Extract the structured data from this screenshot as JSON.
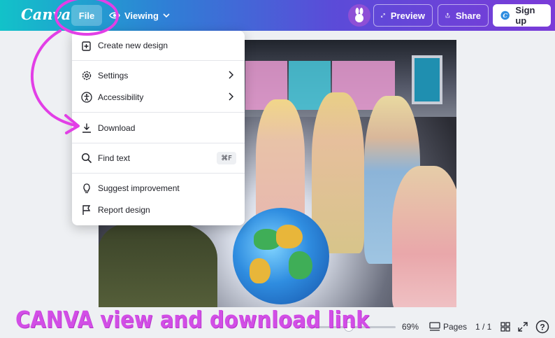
{
  "topbar": {
    "logo": "Canva",
    "file_label": "File",
    "viewing_label": "Viewing",
    "preview_label": "Preview",
    "share_label": "Share",
    "signup_label": "Sign up"
  },
  "menu": {
    "items": [
      {
        "label": "Create new design",
        "icon": "add-page-icon"
      },
      {
        "label": "Settings",
        "icon": "gear-icon"
      },
      {
        "label": "Accessibility",
        "icon": "accessibility-icon"
      },
      {
        "label": "Download",
        "icon": "download-icon"
      },
      {
        "label": "Find text",
        "icon": "search-icon",
        "shortcut": "⌘F"
      },
      {
        "label": "Suggest improvement",
        "icon": "lightbulb-icon"
      },
      {
        "label": "Report design",
        "icon": "flag-icon"
      }
    ]
  },
  "bottombar": {
    "zoom": "69%",
    "pages_label": "Pages",
    "page_count": "1 / 1",
    "help": "?"
  },
  "annotation": {
    "caption": "CANVA view and download link",
    "color": "#d24ee6"
  }
}
